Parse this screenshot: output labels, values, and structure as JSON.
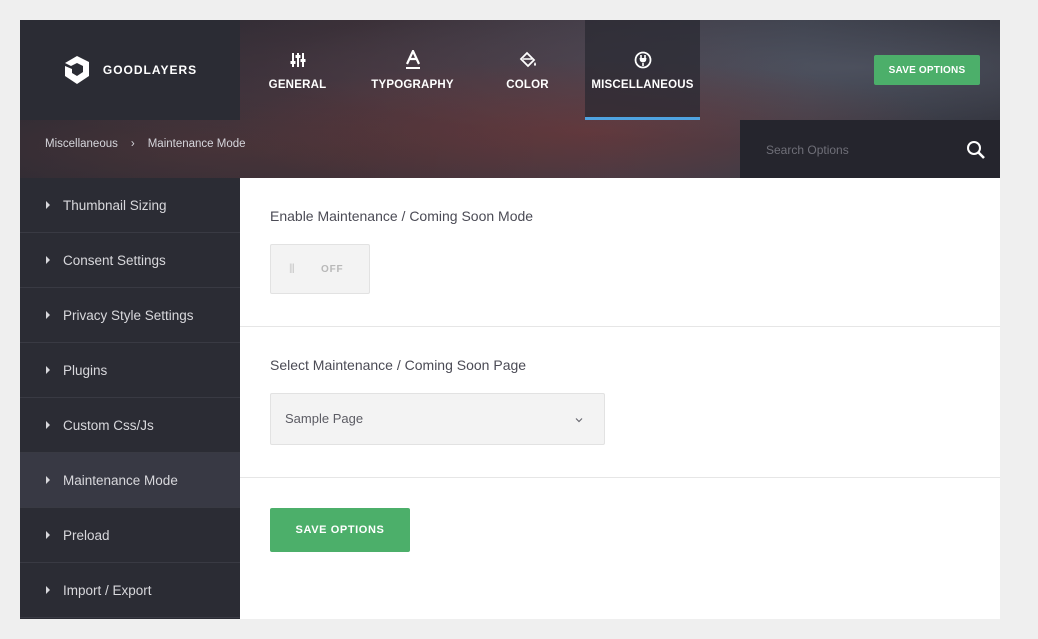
{
  "brand": {
    "name": "GOODLAYERS",
    "icon": "goodlayers-logo"
  },
  "nav_tabs": [
    {
      "label": "GENERAL",
      "icon": "sliders-icon"
    },
    {
      "label": "TYPOGRAPHY",
      "icon": "typography-icon"
    },
    {
      "label": "COLOR",
      "icon": "paint-bucket-icon"
    },
    {
      "label": "MISCELLANEOUS",
      "icon": "plug-icon",
      "active": true
    }
  ],
  "header": {
    "save_label": "SAVE OPTIONS"
  },
  "breadcrumb": {
    "parent": "Miscellaneous",
    "separator": "›",
    "current": "Maintenance Mode"
  },
  "search": {
    "placeholder": "Search Options",
    "icon": "search-icon"
  },
  "sidebar": {
    "items": [
      {
        "label": "Thumbnail Sizing"
      },
      {
        "label": "Consent Settings"
      },
      {
        "label": "Privacy Style Settings"
      },
      {
        "label": "Plugins"
      },
      {
        "label": "Custom Css/Js"
      },
      {
        "label": "Maintenance Mode",
        "active": true
      },
      {
        "label": "Preload"
      },
      {
        "label": "Import / Export"
      }
    ]
  },
  "main": {
    "maintenance_toggle": {
      "label": "Enable Maintenance / Coming Soon Mode",
      "state": "OFF",
      "grip": "|||"
    },
    "page_select": {
      "label": "Select Maintenance / Coming Soon Page",
      "value": "Sample Page"
    },
    "save_label": "SAVE OPTIONS"
  },
  "colors": {
    "accent_green": "#4caf6a",
    "active_tab_underline": "#4fa3e0",
    "sidebar_bg": "#2b2c34"
  }
}
